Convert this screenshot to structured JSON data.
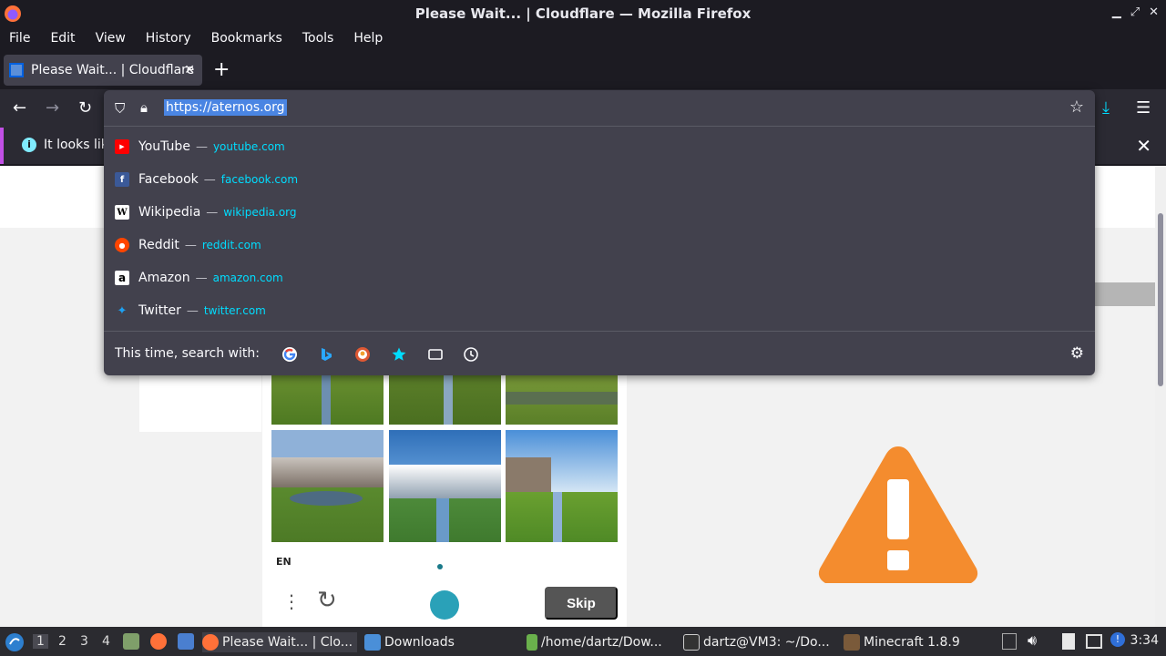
{
  "window": {
    "title": "Please Wait... | Cloudflare — Mozilla Firefox"
  },
  "menu": [
    "File",
    "Edit",
    "View",
    "History",
    "Bookmarks",
    "Tools",
    "Help"
  ],
  "tab": {
    "title": "Please Wait... | Cloudflare"
  },
  "urlbar": {
    "url": "https://aternos.org"
  },
  "notification": {
    "text": "It looks like"
  },
  "suggestions": [
    {
      "name": "YouTube",
      "domain": "youtube.com",
      "color": "#ff0000",
      "glyph": "▶"
    },
    {
      "name": "Facebook",
      "domain": "facebook.com",
      "color": "#3b5998",
      "glyph": "f"
    },
    {
      "name": "Wikipedia",
      "domain": "wikipedia.org",
      "color": "#ffffff",
      "glyph": "W"
    },
    {
      "name": "Reddit",
      "domain": "reddit.com",
      "color": "#ff4500",
      "glyph": "●"
    },
    {
      "name": "Amazon",
      "domain": "amazon.com",
      "color": "#ffffff",
      "glyph": "a"
    },
    {
      "name": "Twitter",
      "domain": "twitter.com",
      "color": "#1da1f2",
      "glyph": "🐦"
    }
  ],
  "search_strip": {
    "label": "This time, search with:"
  },
  "captcha": {
    "lang": "EN",
    "skip": "Skip"
  },
  "taskbar": {
    "workspaces": [
      "1",
      "2",
      "3",
      "4"
    ],
    "tasks": [
      {
        "label": "Please Wait... | Clo..."
      },
      {
        "label": "Downloads"
      },
      {
        "label": "/home/dartz/Dow..."
      },
      {
        "label": "dartz@VM3: ~/Do..."
      },
      {
        "label": "Minecraft 1.8.9"
      }
    ],
    "clock": "3:34"
  }
}
